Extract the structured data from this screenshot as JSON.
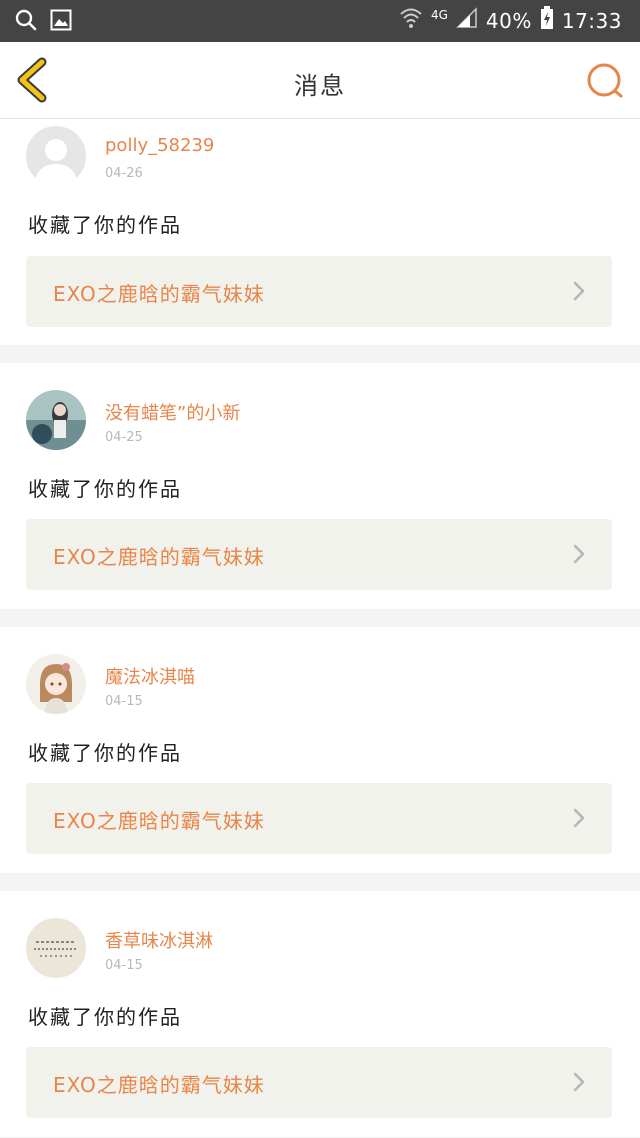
{
  "status_bar": {
    "network": "4G",
    "battery": "40%",
    "time": "17:33"
  },
  "header": {
    "title": "消息"
  },
  "colors": {
    "accent": "#e8854a",
    "back_arrow": "#f3c318",
    "status_bar_bg": "#444444",
    "work_box_bg": "#f2f2ec"
  },
  "messages": [
    {
      "username": "polly_58239",
      "date": "04-26",
      "action": "收藏了你的作品",
      "work_title": "EXO之鹿晗的霸气妹妹",
      "avatar": "default-avatar"
    },
    {
      "username": "没有蜡笔”的小新",
      "date": "04-25",
      "action": "收藏了你的作品",
      "work_title": "EXO之鹿晗的霸气妹妹",
      "avatar": "photo-avatar"
    },
    {
      "username": "魔法冰淇喵",
      "date": "04-15",
      "action": "收藏了你的作品",
      "work_title": "EXO之鹿晗的霸气妹妹",
      "avatar": "anime-avatar"
    },
    {
      "username": "香草味冰淇淋",
      "date": "04-15",
      "action": "收藏了你的作品",
      "work_title": "EXO之鹿晗的霸气妹妹",
      "avatar": "text-avatar"
    }
  ]
}
